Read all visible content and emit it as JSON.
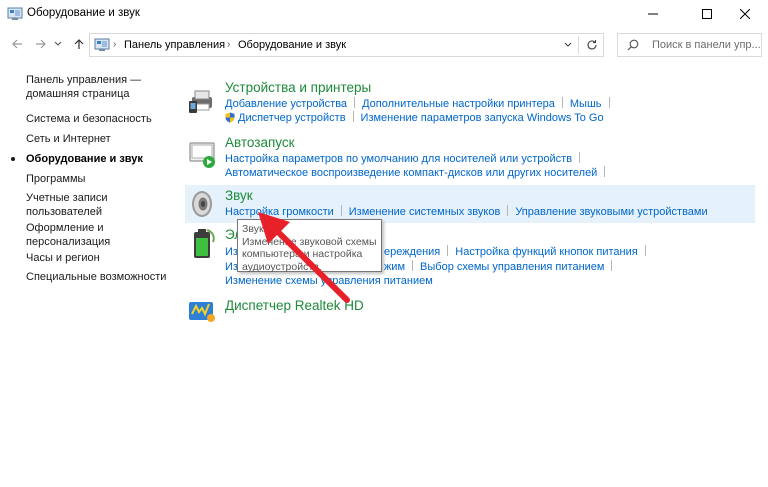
{
  "window": {
    "title": "Оборудование и звук",
    "minimize_icon": "minimize-icon",
    "maximize_icon": "maximize-icon",
    "close_icon": "close-icon"
  },
  "nav": {
    "back_icon": "arrow-left-icon",
    "forward_icon": "arrow-right-icon",
    "recent_icon": "chevron-down-icon",
    "up_icon": "arrow-up-icon",
    "breadcrumb": [
      "Панель управления",
      "Оборудование и звук"
    ],
    "refresh_icon": "refresh-icon",
    "search_placeholder": "Поиск в панели упр..."
  },
  "sidebar": {
    "items": [
      {
        "label": "Панель управления —"
      },
      {
        "label": "домашняя страница"
      },
      {
        "label": "Система и безопасность"
      },
      {
        "label": "Сеть и Интернет"
      },
      {
        "label": "Оборудование и звук"
      },
      {
        "label": "Программы"
      },
      {
        "label": "Учетные записи"
      },
      {
        "label": "пользователей"
      },
      {
        "label": "Оформление и"
      },
      {
        "label": "персонализация"
      },
      {
        "label": "Часы и регион"
      },
      {
        "label": "Специальные возможности"
      }
    ]
  },
  "categories": {
    "devices": {
      "title": "Устройства и принтеры",
      "row1": [
        "Добавление устройства",
        "Дополнительные настройки принтера",
        "Мышь"
      ],
      "row2": [
        "Диспетчер устройств",
        "Изменение параметров запуска Windows To Go"
      ]
    },
    "autoplay": {
      "title": "Автозапуск",
      "row1": [
        "Настройка параметров по умолчанию для носителей или устройств"
      ],
      "row2": [
        "Автоматическое воспроизведение компакт-дисков или других носителей"
      ]
    },
    "sound": {
      "title": "Звук",
      "row1": [
        "Настройка громкости",
        "Изменение системных звуков",
        "Управление звуковыми устройствами"
      ]
    },
    "power": {
      "title_visible": "Эл",
      "row1_a": "Из",
      "row1_b": "ереждения",
      "row1_c": "Настройка функций кнопок питания",
      "row2_a": "Из",
      "row2_b": "жим",
      "row2_c": "Выбор схемы управления питанием",
      "row3": "Изменение схемы управления питанием"
    },
    "realtek": {
      "title": "Диспетчер Realtek HD"
    }
  },
  "tooltip": {
    "line1": "Звук",
    "line2": "Изменение звуковой схемы",
    "line3": "компьютера и настройка",
    "line4": "аудиоустройств."
  },
  "colors": {
    "link": "#0066cc",
    "category_title": "#1e8a3a",
    "highlight": "#e5f1fb",
    "annotation_arrow": "#e8202a"
  }
}
